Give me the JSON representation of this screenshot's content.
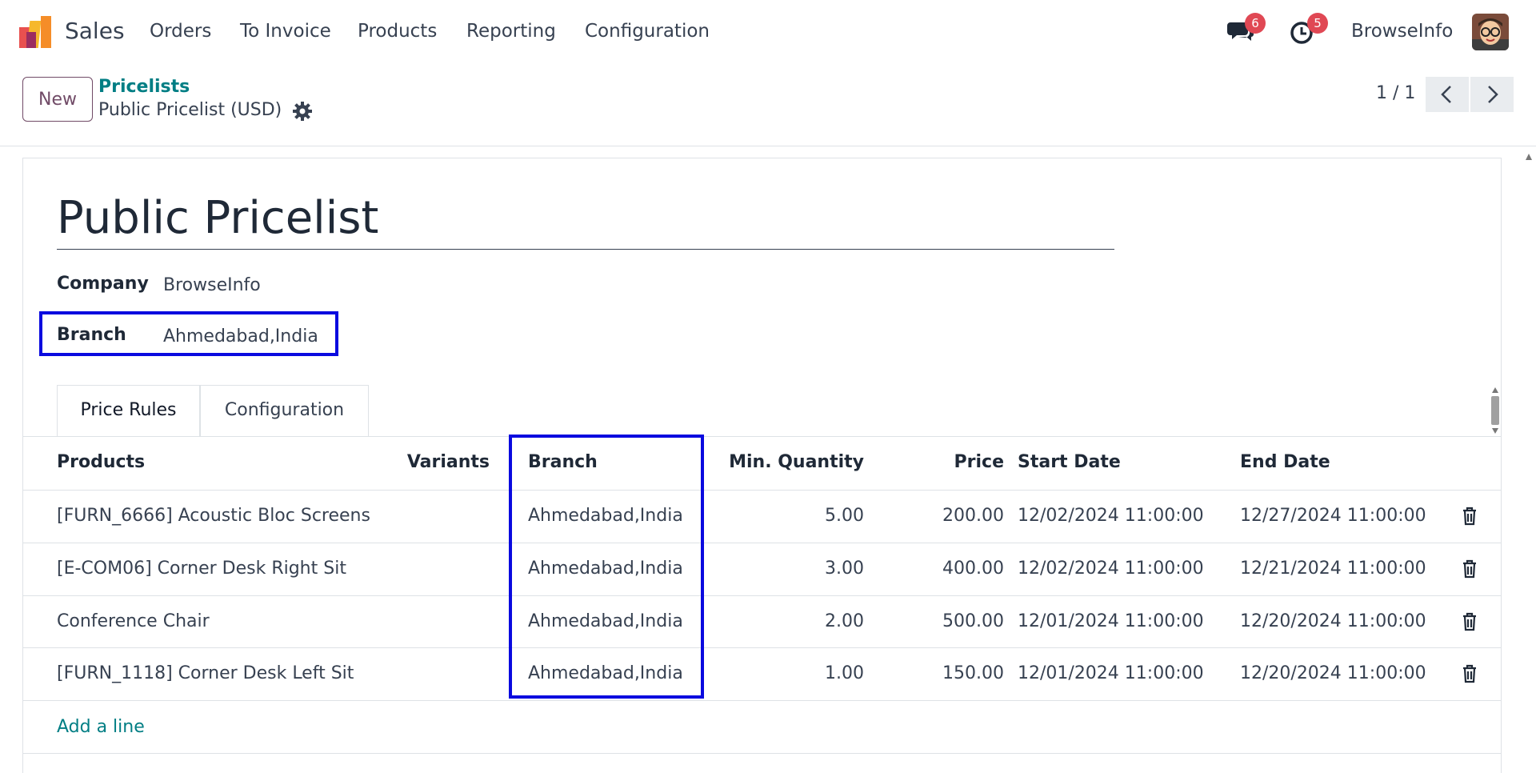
{
  "navbar": {
    "app_name": "Sales",
    "menu": [
      "Orders",
      "To Invoice",
      "Products",
      "Reporting",
      "Configuration"
    ],
    "messages_badge": "6",
    "activities_badge": "5",
    "company": "BrowseInfo"
  },
  "control_panel": {
    "new_label": "New",
    "breadcrumb_parent": "Pricelists",
    "breadcrumb_current": "Public Pricelist (USD)",
    "pager": "1 / 1"
  },
  "form": {
    "title": "Public Pricelist",
    "company_label": "Company",
    "company_value": "BrowseInfo",
    "branch_label": "Branch",
    "branch_value": "Ahmedabad,India"
  },
  "tabs": [
    "Price Rules",
    "Configuration"
  ],
  "table": {
    "headers": [
      "Products",
      "Variants",
      "Branch",
      "Min. Quantity",
      "Price",
      "Start Date",
      "End Date"
    ],
    "rows": [
      {
        "product": "[FURN_6666] Acoustic Bloc Screens",
        "variants": "",
        "branch": "Ahmedabad,India",
        "min_qty": "5.00",
        "price": "200.00",
        "start": "12/02/2024 11:00:00",
        "end": "12/27/2024 11:00:00"
      },
      {
        "product": "[E-COM06] Corner Desk Right Sit",
        "variants": "",
        "branch": "Ahmedabad,India",
        "min_qty": "3.00",
        "price": "400.00",
        "start": "12/02/2024 11:00:00",
        "end": "12/21/2024 11:00:00"
      },
      {
        "product": "Conference Chair",
        "variants": "",
        "branch": "Ahmedabad,India",
        "min_qty": "2.00",
        "price": "500.00",
        "start": "12/01/2024 11:00:00",
        "end": "12/20/2024 11:00:00"
      },
      {
        "product": "[FURN_1118] Corner Desk Left Sit",
        "variants": "",
        "branch": "Ahmedabad,India",
        "min_qty": "1.00",
        "price": "150.00",
        "start": "12/01/2024 11:00:00",
        "end": "12/20/2024 11:00:00"
      }
    ],
    "add_line": "Add a line"
  },
  "colors": {
    "brand": "#714b67",
    "link": "#017e84",
    "highlight": "#0a0adf",
    "badge": "#e04854"
  }
}
